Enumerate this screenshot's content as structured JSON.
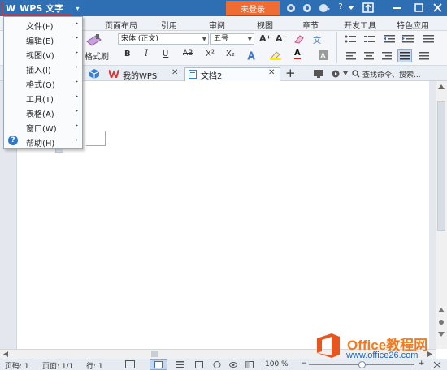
{
  "titlebar": {
    "app_button": "WPS 文字",
    "app_logo": "W",
    "dropdown_arrow": "▾",
    "login_button": "未登录",
    "icons": [
      "skin-icon",
      "gear-icon",
      "settings-icon",
      "help-icon",
      "options-icon",
      "share-icon",
      "minimize-icon",
      "maximize-icon",
      "close-icon"
    ],
    "help_glyph": "?",
    "colors": {
      "titlebar": "#2e6fb4",
      "login": "#ef6c33"
    }
  },
  "ribbon_tabs": [
    "页面布局",
    "引用",
    "审阅",
    "视图",
    "章节",
    "开发工具",
    "特色应用"
  ],
  "toolbar": {
    "format_painter": "格式刷",
    "font_name": "宋体 (正文)",
    "font_size": "五号",
    "bold": "B",
    "italic": "I",
    "underline": "U",
    "strikethrough": "AB",
    "superscript": "X²",
    "subscript": "X₂",
    "grow_font": "A⁺",
    "shrink_font": "A⁻",
    "font_color": "A",
    "phonetic": "文"
  },
  "doc_tabs": {
    "home_tab": "我的WPS",
    "active_tab": "文档2",
    "add_tab": "+",
    "search_placeholder": "查找命令、搜索..."
  },
  "menu": {
    "items": [
      {
        "label": "文件(F)"
      },
      {
        "label": "编辑(E)"
      },
      {
        "label": "视图(V)"
      },
      {
        "label": "插入(I)"
      },
      {
        "label": "格式(O)"
      },
      {
        "label": "工具(T)"
      },
      {
        "label": "表格(A)"
      },
      {
        "label": "窗口(W)"
      },
      {
        "label": "帮助(H)"
      }
    ],
    "help_icon_glyph": "?",
    "submenu_glyph": "▸"
  },
  "statusbar": {
    "page": "页码: 1",
    "pages": "页面: 1/1",
    "line": "行: 1",
    "zoom": "100 %",
    "zoom_minus": "−",
    "zoom_plus": "+"
  },
  "watermark": {
    "brand": "Office教程网",
    "url": "www.office26.com",
    "colors": {
      "brand": "#f27a21",
      "url": "#1a64c0"
    }
  }
}
